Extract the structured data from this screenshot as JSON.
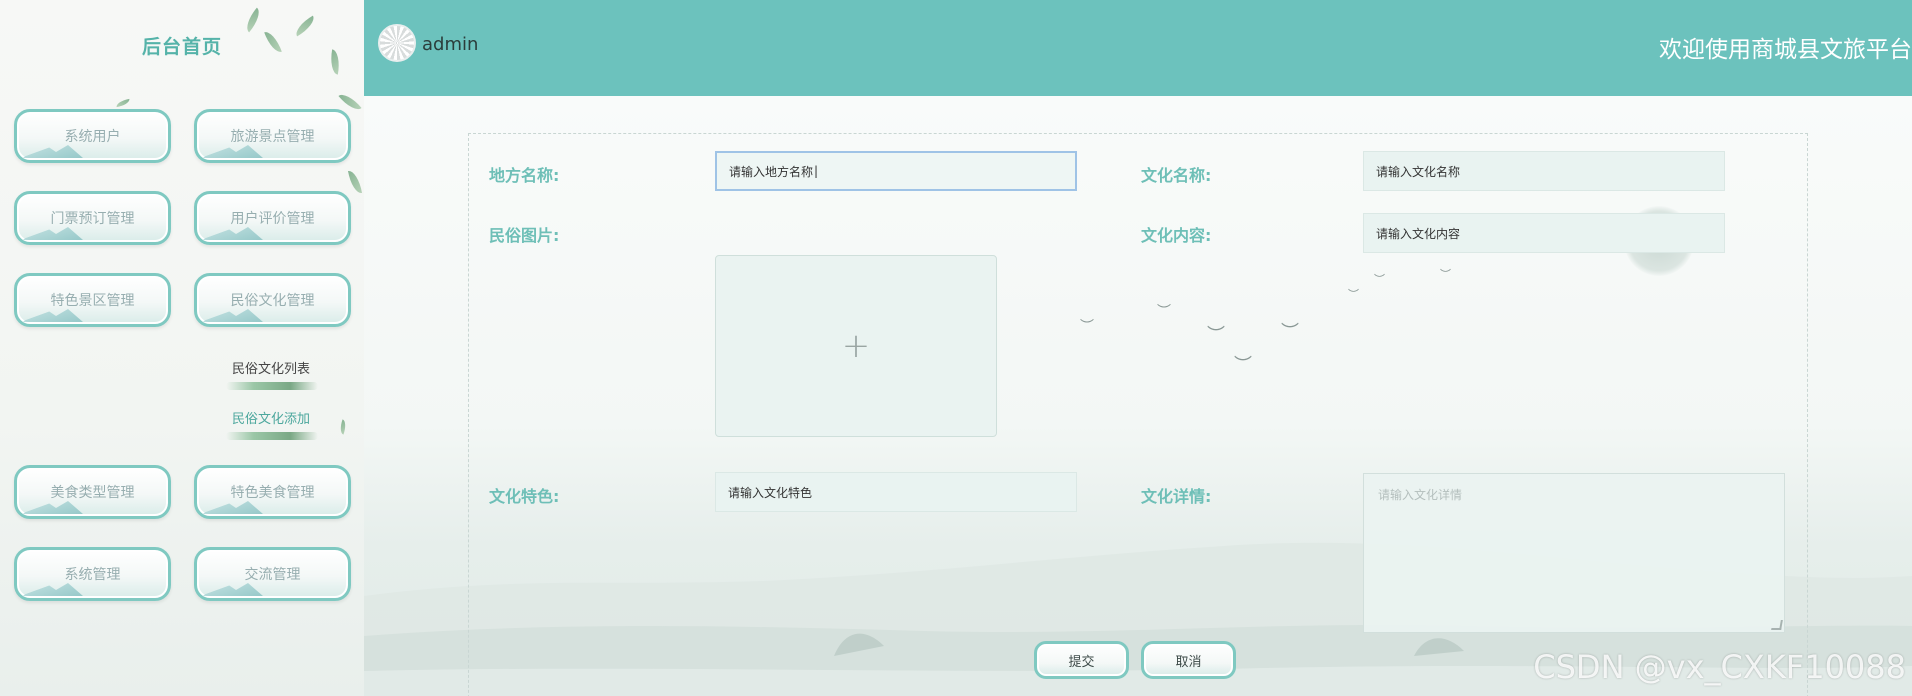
{
  "sidebar": {
    "title": "后台首页",
    "menu": [
      {
        "label": "系统用户"
      },
      {
        "label": "旅游景点管理"
      },
      {
        "label": "门票预订管理"
      },
      {
        "label": "用户评价管理"
      },
      {
        "label": "特色景区管理"
      },
      {
        "label": "民俗文化管理"
      },
      {
        "label": "美食类型管理"
      },
      {
        "label": "特色美食管理"
      },
      {
        "label": "系统管理"
      },
      {
        "label": "交流管理"
      }
    ],
    "submenu": [
      {
        "label": "民俗文化列表"
      },
      {
        "label": "民俗文化添加"
      }
    ]
  },
  "header": {
    "username": "admin",
    "welcome": "欢迎使用商城县文旅平台"
  },
  "form": {
    "place_name_label": "地方名称:",
    "place_name_value": "请输入地方名称",
    "culture_name_label": "文化名称:",
    "culture_name_value": "请输入文化名称",
    "folk_image_label": "民俗图片:",
    "upload_icon": "+",
    "culture_content_label": "文化内容:",
    "culture_content_value": "请输入文化内容",
    "culture_feature_label": "文化特色:",
    "culture_feature_value": "请输入文化特色",
    "culture_detail_label": "文化详情:",
    "culture_detail_placeholder": "请输入文化详情",
    "submit_label": "提交",
    "cancel_label": "取消"
  },
  "watermark": "CSDN @vx_CXKF10088",
  "colors": {
    "header": "#6cc2bd",
    "accent": "#6ebfb7",
    "button_border": "#7fc9c1"
  }
}
